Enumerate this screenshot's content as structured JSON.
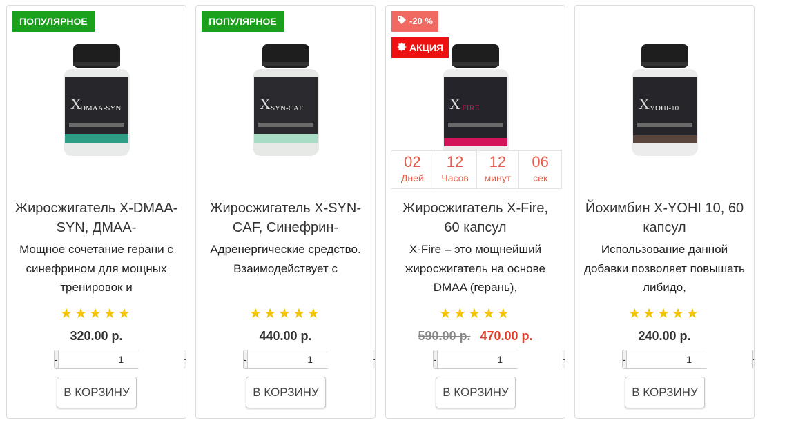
{
  "products": [
    {
      "badges": [
        "ПОПУЛЯРНОЕ"
      ],
      "jar_label": "DMAA-SYN",
      "jar_accent": "#2e9e86",
      "title": "Жиросжигатель X-DMAA-SYN, ДМАА-",
      "description": "Мощное сочетание герани с синефрином для мощных тренировок и",
      "rating": 5,
      "price": "320.00 р.",
      "old_price": "",
      "quantity": "1",
      "qty_minus": "-",
      "qty_plus": "+",
      "cart_label": "В КОРЗИНУ"
    },
    {
      "badges": [
        "ПОПУЛЯРНОЕ"
      ],
      "jar_label": "SYN-CAF",
      "jar_accent": "#a9dcc4",
      "title": "Жиросжигатель X-SYN-CAF, Синефрин-",
      "description": "Адренергические средство. Взаимодействует с",
      "rating": 5,
      "price": "440.00 р.",
      "old_price": "",
      "quantity": "1",
      "qty_minus": "-",
      "qty_plus": "+",
      "cart_label": "В КОРЗИНУ"
    },
    {
      "discount_badge": "-20 %",
      "sale_badge": "АКЦИЯ",
      "jar_label": "FIRE",
      "jar_accent": "#d4145a",
      "timer": [
        {
          "value": "02",
          "label": "Дней"
        },
        {
          "value": "12",
          "label": "Часов"
        },
        {
          "value": "12",
          "label": "минут"
        },
        {
          "value": "06",
          "label": "сек"
        }
      ],
      "title": "Жиросжигатель X-Fire, 60 капсул",
      "description": "X-Fire  – это мощнейший жиросжигатель на основе DMAA (герань),",
      "rating": 5,
      "old_price": "590.00 р.",
      "price": "470.00 р.",
      "quantity": "1",
      "qty_minus": "-",
      "qty_plus": "+",
      "cart_label": "В КОРЗИНУ"
    },
    {
      "badges": [],
      "jar_label": "YOHI-10",
      "jar_accent": "#5a463c",
      "title": "Йохимбин X-YOHI 10, 60 капсул",
      "description": "Использование данной добавки позволяет повышать либидо,",
      "rating": 5,
      "price": "240.00 р.",
      "old_price": "",
      "quantity": "1",
      "qty_minus": "-",
      "qty_plus": "+",
      "cart_label": "В КОРЗИНУ"
    }
  ],
  "colors": {
    "popular_badge": "#1aa01a",
    "discount_badge": "#f06a62",
    "sale_badge": "#ee1111",
    "timer_text": "#e85a4a",
    "star": "#f2c500",
    "sale_price": "#e0402f"
  }
}
